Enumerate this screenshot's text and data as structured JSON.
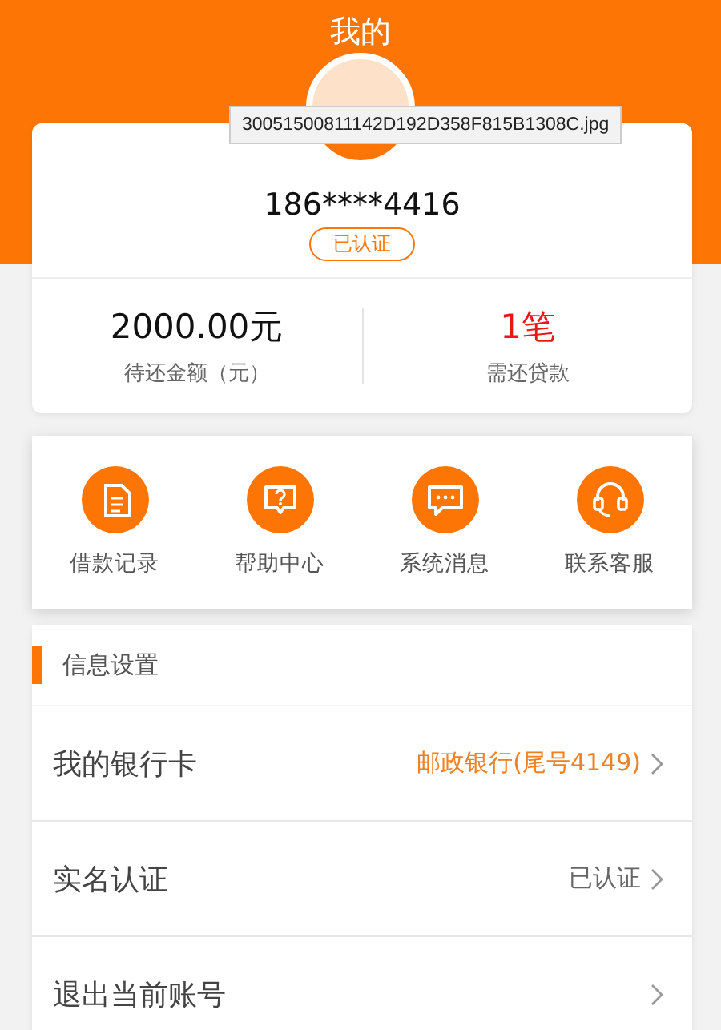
{
  "header": {
    "title": "我的"
  },
  "tooltip": "30051500811142D192D358F815B1308C.jpg",
  "profile": {
    "phone": "186****4416",
    "badge": "已认证"
  },
  "stats": [
    {
      "value": "2000.00元",
      "label": "待还金额（元）",
      "kind": "amount"
    },
    {
      "value": "1笔",
      "label": "需还贷款",
      "kind": "count"
    }
  ],
  "menu": [
    {
      "label": "借款记录"
    },
    {
      "label": "帮助中心"
    },
    {
      "label": "系统消息"
    },
    {
      "label": "联系客服"
    }
  ],
  "settings": {
    "title": "信息设置",
    "rows": [
      {
        "label": "我的银行卡",
        "value": "邮政银行(尾号4149)",
        "color": "#f08020"
      },
      {
        "label": "实名认证",
        "value": "已认证",
        "color": "#666666"
      },
      {
        "label": "退出当前账号"
      }
    ]
  }
}
